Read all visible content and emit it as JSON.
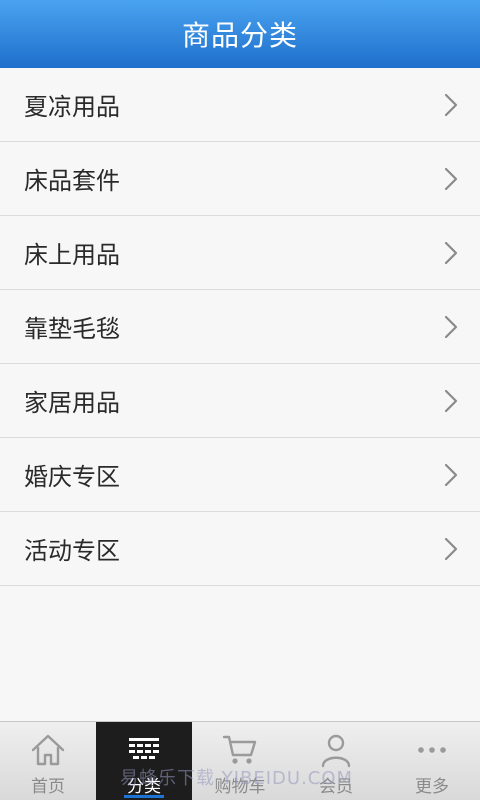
{
  "header": {
    "title": "商品分类"
  },
  "categories": [
    {
      "label": "夏凉用品"
    },
    {
      "label": "床品套件"
    },
    {
      "label": "床上用品"
    },
    {
      "label": "靠垫毛毯"
    },
    {
      "label": "家居用品"
    },
    {
      "label": "婚庆专区"
    },
    {
      "label": "活动专区"
    }
  ],
  "tabs": [
    {
      "label": "首页",
      "icon": "home-icon"
    },
    {
      "label": "分类",
      "icon": "category-icon",
      "active": true
    },
    {
      "label": "购物车",
      "icon": "cart-icon"
    },
    {
      "label": "会员",
      "icon": "user-icon"
    },
    {
      "label": "更多",
      "icon": "more-icon"
    }
  ],
  "watermark": {
    "text": "易蜂乐下载 YIBEIDU.COM"
  },
  "colors": {
    "header": "#1e6fcb",
    "active_tab": "#1d1d1d",
    "active_indicator": "#1e73d6"
  }
}
